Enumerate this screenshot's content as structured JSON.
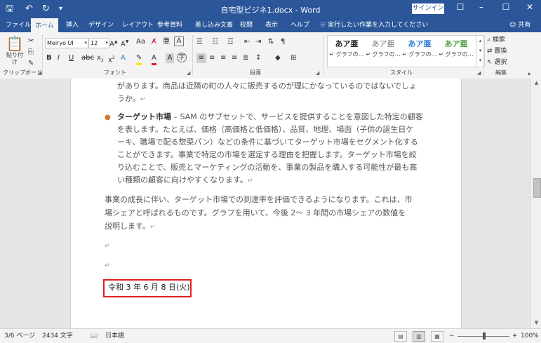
{
  "titlebar": {
    "title": "自宅型ビジネ1.docx - Word",
    "signin": "サインイン",
    "save_icon": "save-icon",
    "undo_icon": "undo-icon",
    "redo_icon": "redo-icon",
    "customize_icon": "customize-icon"
  },
  "tabs": [
    "ファイル",
    "ホーム",
    "挿入",
    "デザイン",
    "レイアウト",
    "参考資料",
    "差し込み文書",
    "校閲",
    "表示",
    "ヘルプ"
  ],
  "active_tab": "ホーム",
  "tellme": "実行したい作業を入力してください",
  "share": "共有",
  "ribbon": {
    "clipboard": {
      "paste": "貼り付け",
      "label": "クリップボード"
    },
    "font": {
      "name": "Meiryo UI",
      "size": "12",
      "label": "フォント"
    },
    "paragraph": {
      "label": "段落"
    },
    "styles": {
      "label": "スタイル",
      "items": [
        {
          "sample": "あア亜",
          "name": "↵ グラフの…"
        },
        {
          "sample": "あア亜",
          "name": "↵ グラフの…"
        },
        {
          "sample": "あア亜",
          "name": "↵ グラフの…"
        },
        {
          "sample": "あア亜",
          "name": "↵ グラフの…"
        }
      ]
    },
    "editing": {
      "find": "検索",
      "replace": "置換",
      "select": "選択",
      "label": "編集"
    }
  },
  "document": {
    "line1": "があります。商品は近隣の町の人々に販売するのが理にかなっているのではないでしょ",
    "line2": "うか。",
    "bullet_title": "ターゲット市場",
    "bullet_line1": " – SAM のサブセットで、サービスを提供することを意図した特定の顧客",
    "bullet_line2": "を表します。たとえば、価格（高価格と低価格）、品質、地理、場面（子供の誕生日ケ",
    "bullet_line3": "ーキ、職場で配る惣菜パン）などの条件に基づいてターゲット市場をセグメント化する",
    "bullet_line4": "ことができます。事業で特定の市場を選定する理由を把握します。ターゲット市場を絞",
    "bullet_line5": "り込むことで、販売とマーケティングの活動を、事業の製品を購入する可能性が最も高",
    "bullet_line6": "い種類の顧客に向けやすくなります。",
    "para_line1": "事業の成長に伴い、ターゲット市場での到達率を評価できるようになります。これは、市",
    "para_line2": "場シェアと呼ばれるものです。グラフを用いて、今後 2～ 3 年間の市場シェアの数値を",
    "para_line3": "説明します。",
    "paragraph_mark": "↵",
    "date": "令和 3 年 6 月 8 日(火)"
  },
  "statusbar": {
    "page": "3/6 ページ",
    "words": "2434 文字",
    "language": "日本語",
    "zoom": "100%"
  }
}
